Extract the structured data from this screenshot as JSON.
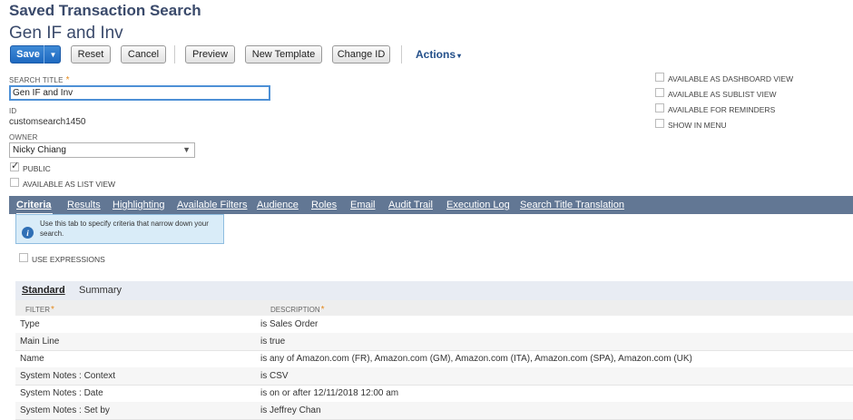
{
  "header": {
    "page_type": "Saved Transaction Search",
    "record_title": "Gen IF and Inv"
  },
  "toolbar": {
    "save_label": "Save",
    "save_dropdown_glyph": "▼",
    "reset_label": "Reset",
    "cancel_label": "Cancel",
    "preview_label": "Preview",
    "new_template_label": "New Template",
    "change_id_label": "Change ID",
    "actions_label": "Actions",
    "actions_caret": "▾"
  },
  "form": {
    "search_title_label": "SEARCH TITLE",
    "required_marker": "*",
    "search_title_value": "Gen IF and Inv",
    "id_label": "ID",
    "id_value": "customsearch1450",
    "owner_label": "OWNER",
    "owner_value": "Nicky Chiang",
    "public_label": "PUBLIC",
    "public_checked": true,
    "list_view_label": "AVAILABLE AS LIST VIEW",
    "list_view_checked": false
  },
  "right_options": [
    {
      "label": "AVAILABLE AS DASHBOARD VIEW",
      "checked": false
    },
    {
      "label": "AVAILABLE AS SUBLIST VIEW",
      "checked": false
    },
    {
      "label": "AVAILABLE FOR REMINDERS",
      "checked": false
    },
    {
      "label": "SHOW IN MENU",
      "checked": false
    }
  ],
  "tabs": [
    {
      "label": "Criteria",
      "active": true
    },
    {
      "label": "Results"
    },
    {
      "label": "Highlighting"
    },
    {
      "label": "Available Filters"
    },
    {
      "label": "Audience"
    },
    {
      "label": "Roles"
    },
    {
      "label": "Email"
    },
    {
      "label": "Audit Trail"
    },
    {
      "label": "Execution Log"
    },
    {
      "label": "Search Title Translation"
    }
  ],
  "info": {
    "text": "Use this tab to specify criteria that narrow down your search."
  },
  "use_expressions_label": "USE EXPRESSIONS",
  "subtabs": [
    {
      "label": "Standard",
      "active": true,
      "marker": "•"
    },
    {
      "label": "Summary"
    }
  ],
  "criteria_table": {
    "columns": [
      "FILTER",
      "DESCRIPTION"
    ],
    "rows": [
      {
        "filter": "Type",
        "description": "is Sales Order"
      },
      {
        "filter": "Main Line",
        "description": "is true"
      },
      {
        "filter": "Name",
        "description": "is any of Amazon.com (FR), Amazon.com (GM), Amazon.com (ITA), Amazon.com (SPA), Amazon.com (UK)"
      },
      {
        "filter": "System Notes : Context",
        "description": "is CSV"
      },
      {
        "filter": "System Notes : Date",
        "description": "is on or after 12/11/2018 12:00 am"
      },
      {
        "filter": "System Notes : Set by",
        "description": "is Jeffrey Chan"
      }
    ]
  },
  "colors": {
    "title": "#3a4a6b",
    "tabbar": "#627794",
    "save_button": "#1e69c0",
    "required": "#e58a1c",
    "info_bg": "#d9ecf8"
  }
}
